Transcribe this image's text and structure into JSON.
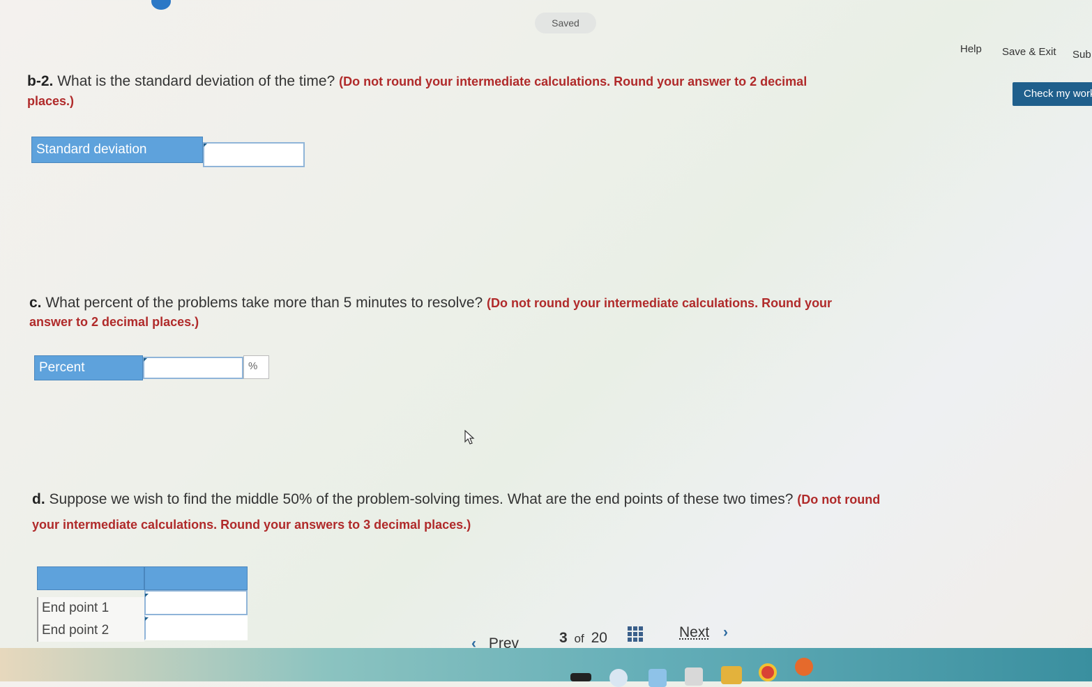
{
  "header": {
    "saved": "Saved",
    "help": "Help",
    "save_exit": "Save & Exit",
    "submit": "Sub",
    "check_work": "Check my work"
  },
  "questions": {
    "b2": {
      "prefix": "b-2.",
      "text": "What is the standard deviation of the time?",
      "instruction_part1": "(Do not round your intermediate calculations. Round your answer to 2 decimal",
      "instruction_part2": "places.)",
      "field_label": "Standard deviation",
      "value": ""
    },
    "c": {
      "prefix": "c.",
      "text": "What percent of the problems take more than 5 minutes to resolve?",
      "instruction_part1": "(Do not round your intermediate calculations. Round your",
      "instruction_part2": "answer to 2 decimal places.)",
      "field_label": "Percent",
      "unit": "%",
      "value": ""
    },
    "d": {
      "prefix": "d.",
      "text": "Suppose we wish to find the middle 50% of the problem-solving times. What are the end points of these two times?",
      "instruction_part1": "(Do not round",
      "instruction_part2": "your intermediate calculations. Round your answers to 3 decimal places.)",
      "rows": [
        "End point 1",
        "End point 2"
      ]
    }
  },
  "nav": {
    "prev": "Prev",
    "current": "3",
    "of": "of",
    "total": "20",
    "next": "Next"
  }
}
